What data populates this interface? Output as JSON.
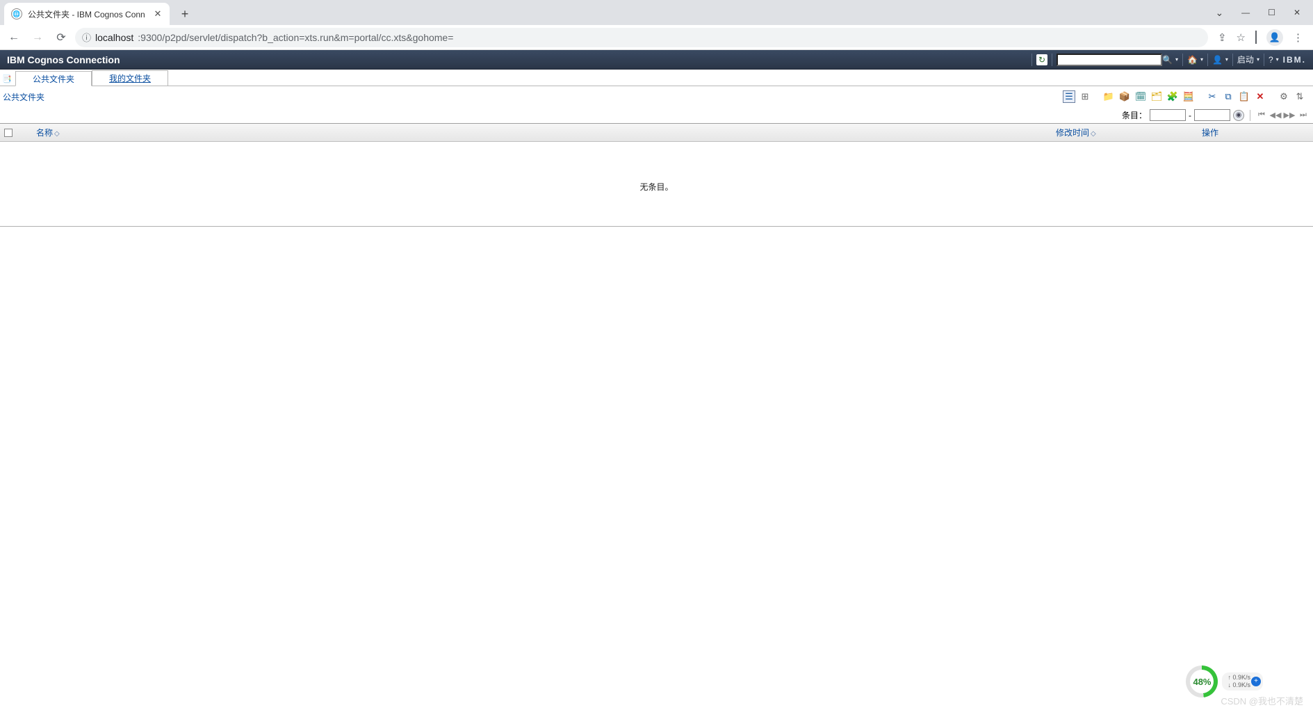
{
  "browser": {
    "tab_title": "公共文件夹 - IBM Cognos Conn",
    "url_host": "localhost",
    "url_path": ":9300/p2pd/servlet/dispatch?b_action=xts.run&m=portal/cc.xts&gohome="
  },
  "cognos": {
    "title": "IBM Cognos Connection",
    "launch_label": "启动",
    "ibm_logo": "IBM."
  },
  "tabs": {
    "active": "公共文件夹",
    "inactive": "我的文件夹"
  },
  "breadcrumb": "公共文件夹",
  "paging": {
    "label": "条目：",
    "from": "",
    "sep": "-",
    "to": ""
  },
  "grid": {
    "col_name": "名称",
    "col_modified": "修改时间",
    "col_action": "操作"
  },
  "empty": "无条目。",
  "gauge": {
    "percent": "48%",
    "up": "↑ 0.9K/s",
    "down": "↓ 0.9K/s"
  },
  "watermark": "CSDN @我也不清楚"
}
